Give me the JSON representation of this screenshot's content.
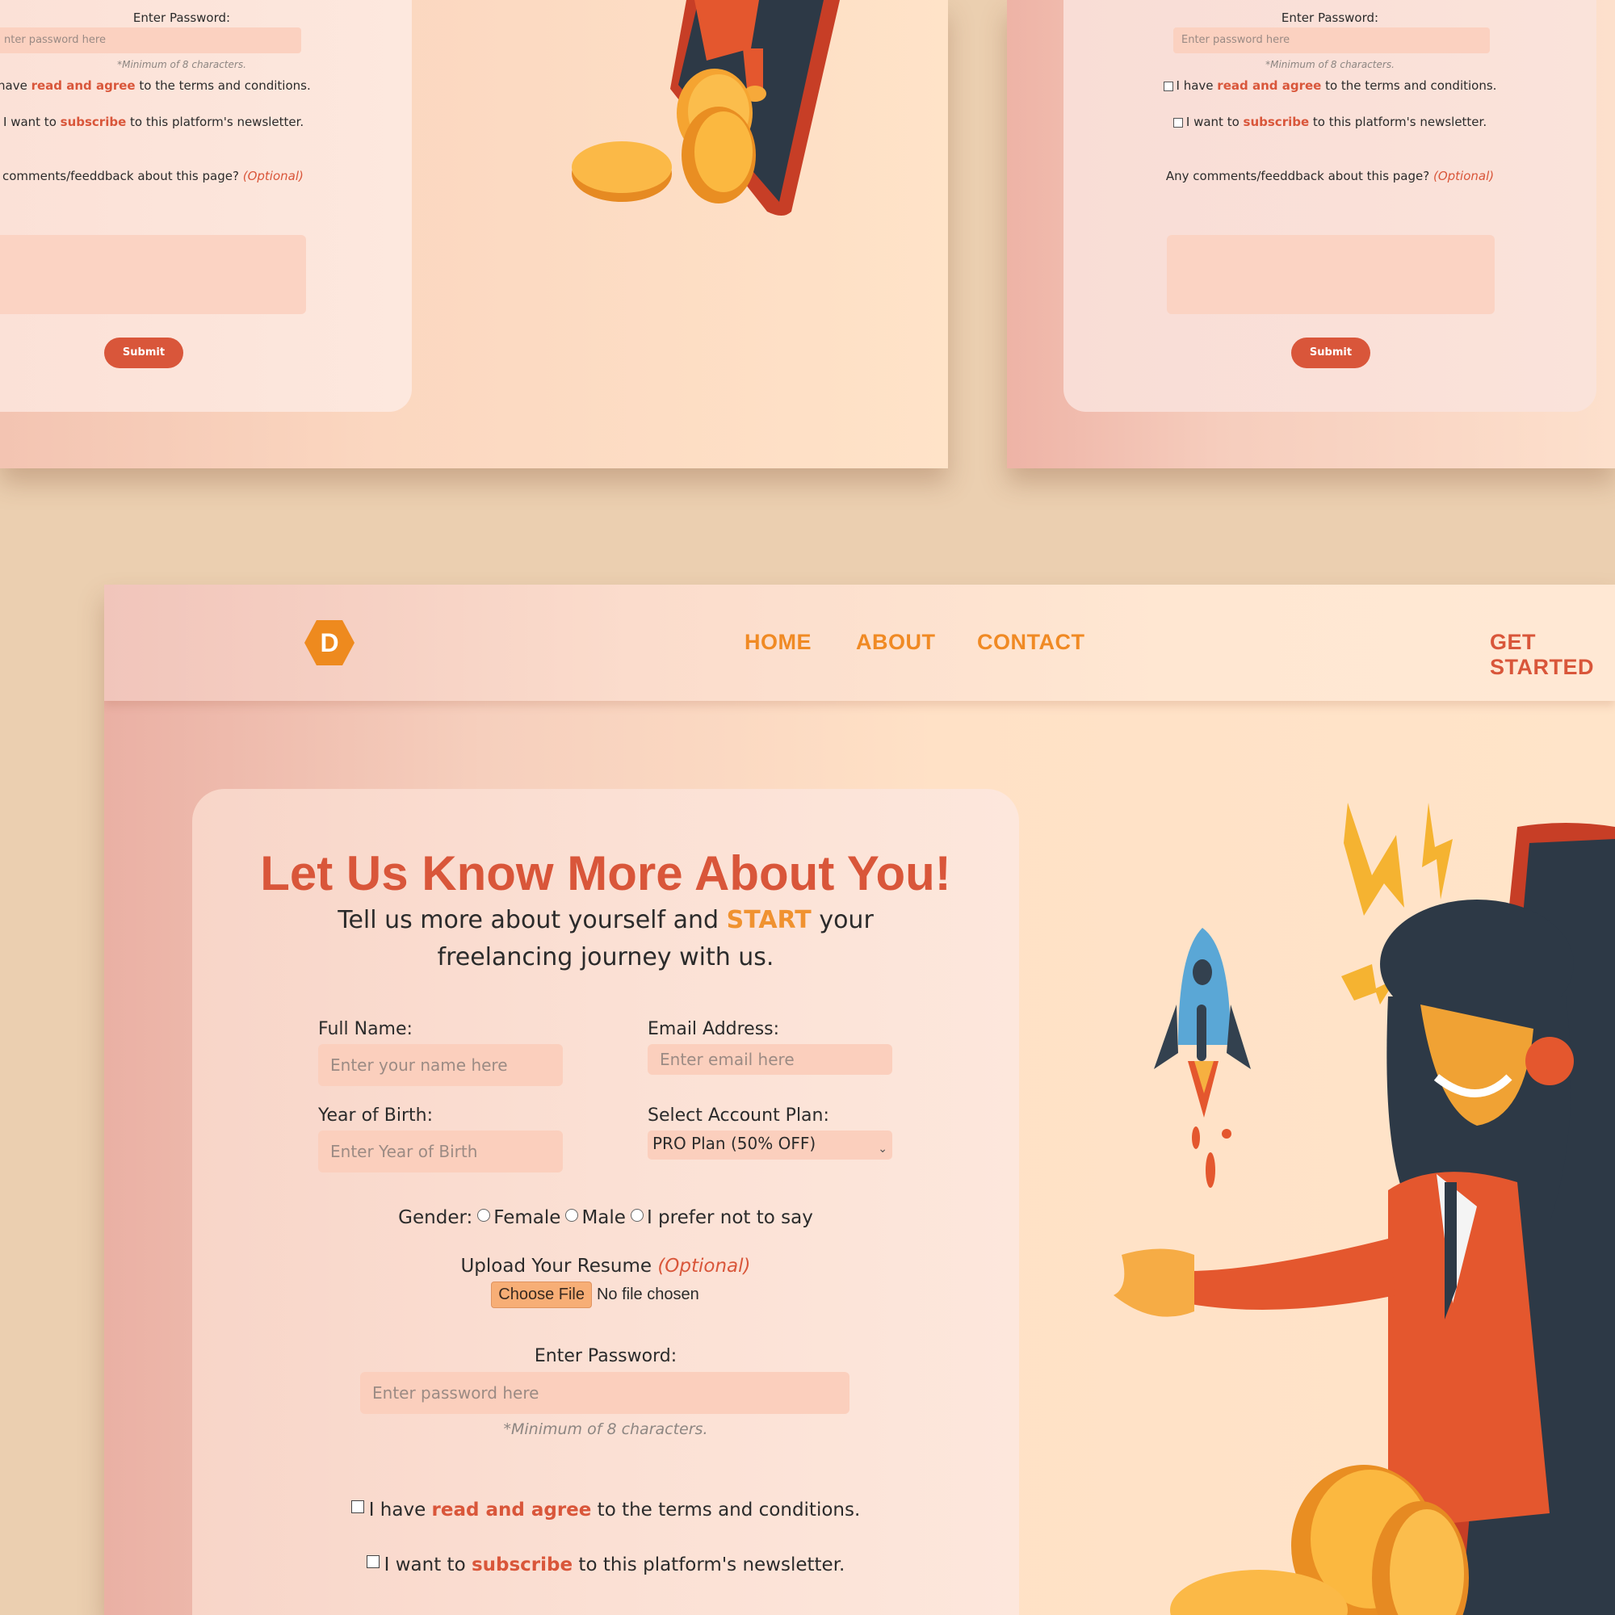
{
  "form": {
    "password_label": "Enter Password:",
    "password_placeholder": "Enter password here",
    "password_placeholder_cropped": "nter password here",
    "password_note": "*Minimum of 8 characters.",
    "terms_prefix": "I have ",
    "terms_highlight": "read and agree",
    "terms_suffix": " to the terms and conditions.",
    "newsletter_prefix": "I want to ",
    "newsletter_highlight": "subscribe",
    "newsletter_suffix": " to this platform's newsletter.",
    "comments_label": "Any comments/feeddback about this page?",
    "comments_label_cropped": "comments/feeddback about this page?",
    "comments_optional": "(Optional)",
    "submit_label": "Submit",
    "terms_prefix_cropped": "have "
  },
  "nav": {
    "logo_letter": "D",
    "links": [
      "HOME",
      "ABOUT",
      "CONTACT"
    ],
    "cta": "GET STARTED"
  },
  "main": {
    "title": "Let Us Know More About You!",
    "subtitle_before": "Tell us more about yourself and ",
    "subtitle_highlight": "START",
    "subtitle_after": " your freelancing journey with us.",
    "full_name_label": "Full Name:",
    "full_name_placeholder": "Enter your name here",
    "email_label": "Email Address:",
    "email_placeholder": "Enter email here",
    "yob_label": "Year of Birth:",
    "yob_placeholder": "Enter Year of Birth",
    "plan_label": "Select Account Plan:",
    "plan_selected": "PRO Plan (50% OFF)",
    "gender_label": "Gender:",
    "gender_options": [
      "Female",
      "Male",
      "I prefer not to say"
    ],
    "resume_label": "Upload Your Resume",
    "resume_optional": "(Optional)",
    "choose_file": "Choose File",
    "no_file": "No file chosen"
  },
  "colors": {
    "accent": "#d9563a",
    "orange": "#f08a24",
    "input_bg": "#fbcfbd",
    "page_bg": "#ebcfb0"
  }
}
